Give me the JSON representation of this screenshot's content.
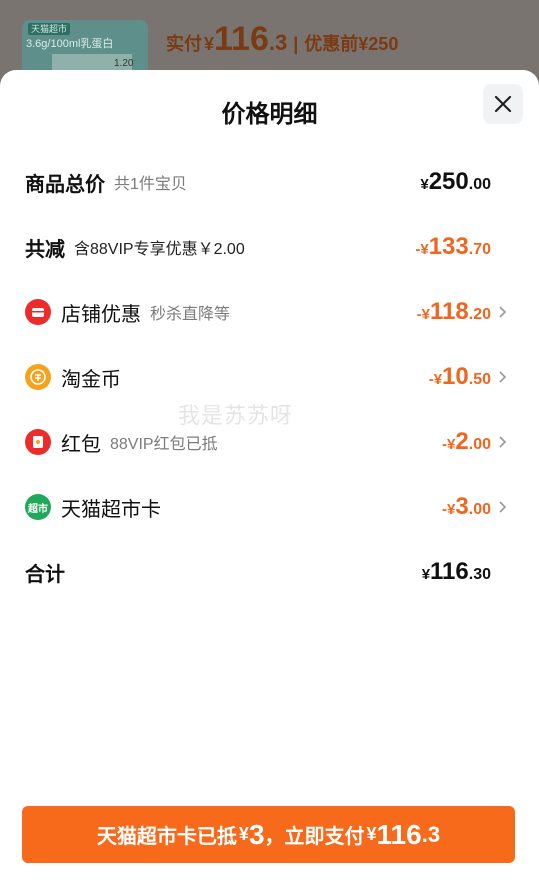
{
  "background_header": {
    "thumb_tag": "天猫超市",
    "thumb_line": "3.6g/100ml乳蛋白",
    "thumb_corner": "1.20",
    "paid_label": "实付",
    "currency": "¥",
    "paid_int": "116",
    "paid_dec": ".3",
    "separator": "|",
    "orig_label": "优惠前",
    "orig_amount": "¥250"
  },
  "sheet": {
    "title": "价格明细",
    "close_icon": "close-icon"
  },
  "rows": [
    {
      "label": "商品总价",
      "sub": "共1件宝贝",
      "sym": "¥",
      "int": "250",
      "dec": ".00",
      "color": "#111111"
    },
    {
      "label": "共减",
      "sub": "含88VIP专享优惠￥2.00",
      "sym": "-¥",
      "int": "133",
      "dec": ".70",
      "color": "#f0661e"
    },
    {
      "label": "店铺优惠",
      "sub": "秒杀直降等",
      "sym": "-¥",
      "int": "118",
      "dec": ".20",
      "icon": "shop-coupon-icon",
      "icon_color": "#ee2b2b"
    },
    {
      "label": "淘金币",
      "sub": "",
      "sym": "-¥",
      "int": "10",
      "dec": ".50",
      "icon": "gold-coin-icon",
      "icon_color": "#f7a21b"
    },
    {
      "label": "红包",
      "sub": "88VIP红包已抵",
      "sym": "-¥",
      "int": "2",
      "dec": ".00",
      "icon": "red-envelope-icon",
      "icon_color": "#ee2b2b"
    },
    {
      "label": "天猫超市卡",
      "sub": "",
      "sym": "-¥",
      "int": "3",
      "dec": ".00",
      "icon": "supermarket-card-icon",
      "icon_color": "#21a85a",
      "icon_text": "超市"
    },
    {
      "label": "合计",
      "sub": "",
      "sym": "¥",
      "int": "116",
      "dec": ".30",
      "color": "#111111"
    }
  ],
  "watermark": "我是苏苏呀",
  "pay_button": {
    "prefix": "天猫超市卡已抵",
    "sym1": "¥",
    "deduct": "3",
    "middle": "，立即支付",
    "sym2": "¥",
    "pay_int": "116",
    "pay_dec": ".3"
  },
  "colors": {
    "accent_orange": "#f0661e",
    "button_orange": "#f86a1b"
  }
}
